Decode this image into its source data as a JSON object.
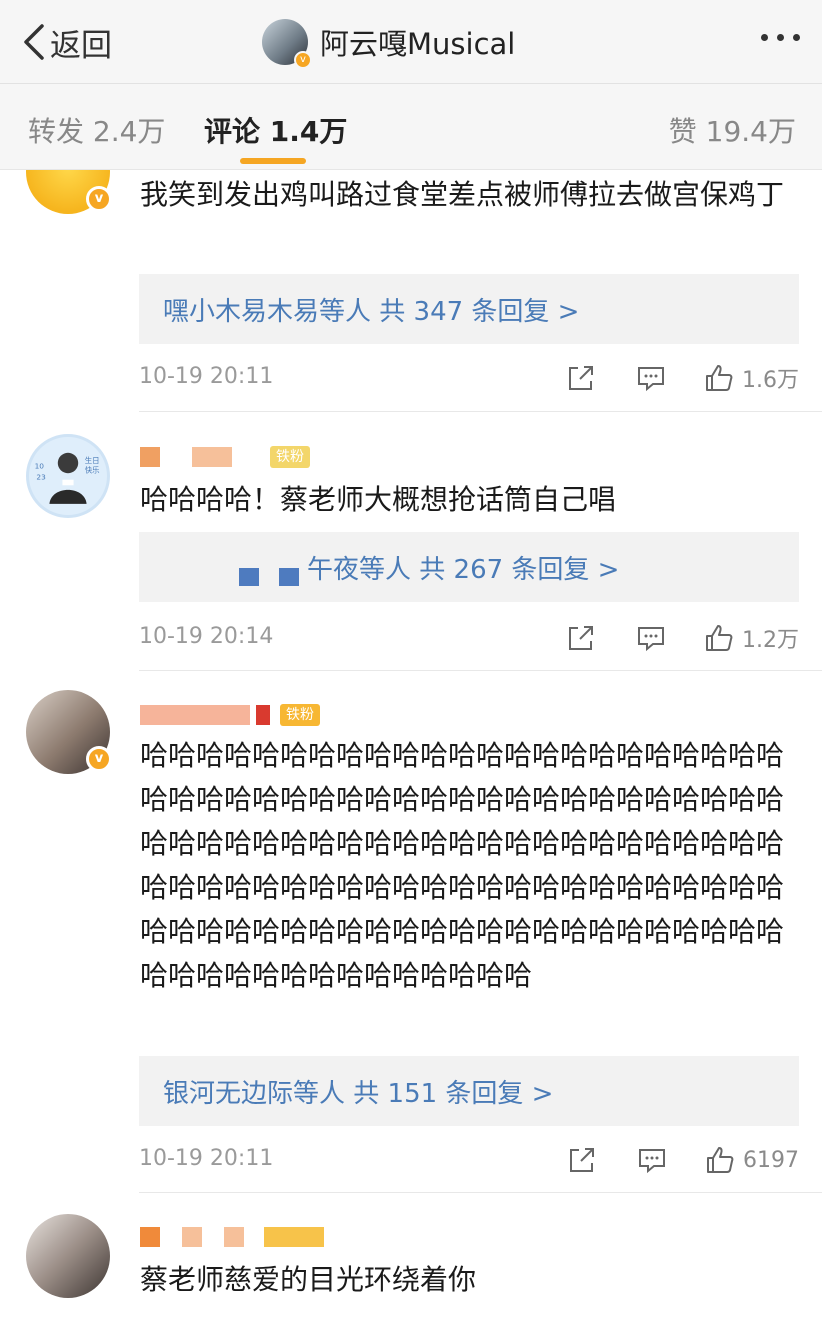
{
  "header": {
    "back_label": "返回",
    "title": "阿云嘎Musical"
  },
  "tabs": {
    "repost": "转发 2.4万",
    "comments": "评论 1.4万",
    "likes": "赞 19.4万"
  },
  "comments": [
    {
      "text": "我笑到发出鸡叫路过食堂差点被师傅拉去做宫保鸡丁",
      "replies": "嘿小木易木易等人  共 347 条回复 >",
      "time": "10-19 20:11",
      "likes": "1.6万"
    },
    {
      "fan_badge": "铁粉",
      "text": "哈哈哈哈！蔡老师大概想抢话筒自己唱",
      "replies": "午夜等人  共 267 条回复 >",
      "time": "10-19 20:14",
      "likes": "1.2万",
      "avatar_texts": [
        "10",
        "23",
        "生日",
        "快乐"
      ]
    },
    {
      "fan_badge": "铁粉",
      "text": "哈哈哈哈哈哈哈哈哈哈哈哈哈哈哈哈哈哈哈哈哈哈哈哈哈哈哈哈哈哈哈哈哈哈哈哈哈哈哈哈哈哈哈哈哈哈哈哈哈哈哈哈哈哈哈哈哈哈哈哈哈哈哈哈哈哈哈哈哈哈哈哈哈哈哈哈哈哈哈哈哈哈哈哈哈哈哈哈哈哈哈哈哈哈哈哈哈哈哈哈哈哈哈哈哈哈哈哈哈哈哈哈哈哈哈哈哈哈哈哈哈哈哈哈哈哈哈哈哈",
      "replies": "银河无边际等人  共 151 条回复 >",
      "time": "10-19 20:11",
      "likes": "6197"
    },
    {
      "text": "蔡老师慈爱的目光环绕着你"
    }
  ],
  "icons": {
    "back": "chevron-left-icon",
    "more": "more-dots-icon",
    "share": "share-icon",
    "comment": "comment-icon",
    "like": "thumbs-up-icon",
    "verified": "verified-badge-icon"
  },
  "colors": {
    "accent": "#f5a623",
    "link": "#4a7bb7",
    "badge": "#f7b733"
  }
}
